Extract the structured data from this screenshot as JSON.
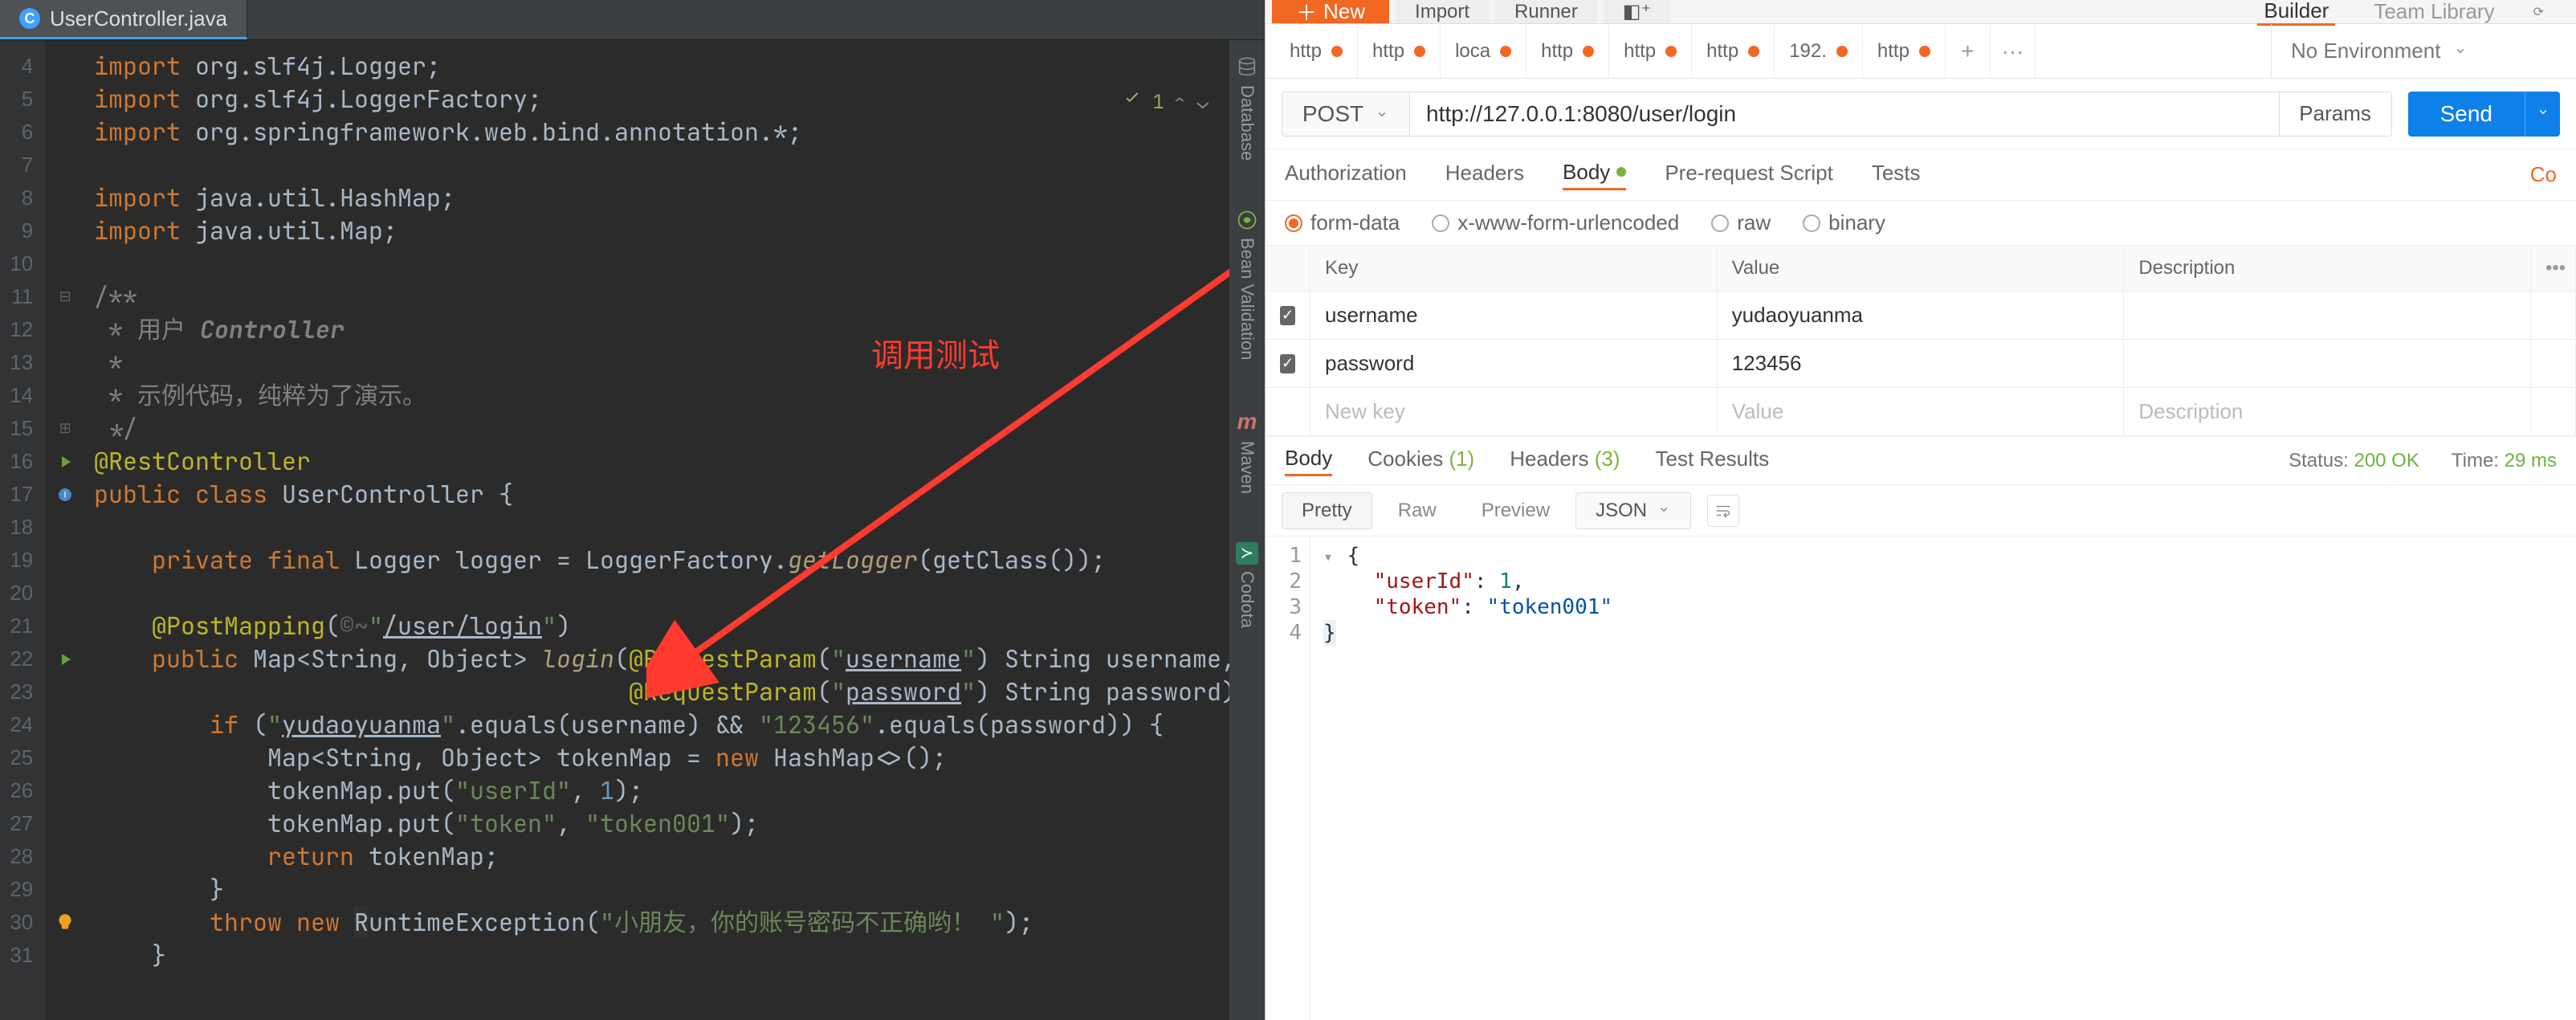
{
  "ide": {
    "tab": {
      "filename": "UserController.java"
    },
    "indicator": {
      "text": "1",
      "arrows": "⌃ ⌄"
    },
    "annotation": "调用测试",
    "side_tools": [
      "Database",
      "Bean Validation",
      "Maven",
      "Codota"
    ],
    "gutter": {
      "start": 4,
      "end": 31
    },
    "code": [
      {
        "n": 4,
        "html": "<span class='kw'>import</span> org.slf4j.Logger;"
      },
      {
        "n": 5,
        "html": "<span class='kw'>import</span> org.slf4j.LoggerFactory;"
      },
      {
        "n": 6,
        "html": "<span class='kw'>import</span> org.springframework.web.bind.annotation.*;"
      },
      {
        "n": 7,
        "html": ""
      },
      {
        "n": 8,
        "html": "<span class='kw'>import</span> java.util.HashMap;"
      },
      {
        "n": 9,
        "html": "<span class='kw'>import</span> java.util.Map;"
      },
      {
        "n": 10,
        "html": ""
      },
      {
        "n": 11,
        "html": "<span class='cmt'>/**</span>",
        "fold": "open"
      },
      {
        "n": 12,
        "html": "<span class='cmt'> * 用户 </span><span class='cmtkw'>Controller</span>"
      },
      {
        "n": 13,
        "html": "<span class='cmt'> *</span>"
      },
      {
        "n": 14,
        "html": "<span class='cmt'> * 示例代码，纯粹为了演示。</span>"
      },
      {
        "n": 15,
        "html": "<span class='cmt'> */</span>",
        "fold": "close"
      },
      {
        "n": 16,
        "html": "<span class='ann'>@RestController</span>",
        "decor": "run-green"
      },
      {
        "n": 17,
        "html": "<span class='kw'>public class</span> <span class='cls'>UserController</span> {",
        "decor": "impl"
      },
      {
        "n": 18,
        "html": ""
      },
      {
        "n": 19,
        "html": "    <span class='kw'>private final</span> Logger <span class='ident'>logger</span> = LoggerFactory.<span class='call'>getLogger</span>(getClass());"
      },
      {
        "n": 20,
        "html": ""
      },
      {
        "n": 21,
        "html": "    <span class='ann'>@PostMapping</span>(<span class='fold'>©~</span><span class='str'>\"</span><span class='str param'>/user/login</span><span class='str'>\"</span>)"
      },
      {
        "n": 22,
        "html": "    <span class='kw'>public</span> Map&lt;String, Object&gt; <span class='call'>login</span>(<span class='ann'>@RequestParam</span>(<span class='str'>\"</span><span class='str param'>username</span><span class='str'>\"</span>) String username,",
        "decor": "run-green"
      },
      {
        "n": 23,
        "html": "                                     <span class='ann'>@RequestParam</span>(<span class='str'>\"</span><span class='str param'>password</span><span class='str'>\"</span>) String password) {"
      },
      {
        "n": 24,
        "html": "        <span class='kw'>if</span> (<span class='str'>\"</span><span class='str param'>yudaoyuanma</span><span class='str'>\"</span>.equals(username) &amp;&amp; <span class='str'>\"123456\"</span>.equals(password)) {"
      },
      {
        "n": 25,
        "html": "            Map&lt;String, Object&gt; tokenMap = <span class='kw'>new</span> HashMap&lt;&gt;();"
      },
      {
        "n": 26,
        "html": "            tokenMap.put(<span class='str'>\"userId\"</span>, <span class='num'>1</span>);"
      },
      {
        "n": 27,
        "html": "            tokenMap.put(<span class='str'>\"token\"</span>, <span class='str'>\"token001\"</span>);"
      },
      {
        "n": 28,
        "html": "            <span class='kw'>return</span> tokenMap;"
      },
      {
        "n": 29,
        "html": "        }"
      },
      {
        "n": 30,
        "html": "        <span class='kw'>throw new</span> <span class='cursor-bg'>R</span>untimeException(<span class='str'>\"小朋友，你的账号密码不正确哟！ \"</span>);",
        "decor": "bulb"
      },
      {
        "n": 31,
        "html": "    }"
      }
    ]
  },
  "postman": {
    "topbar": {
      "new": "New",
      "import": "Import",
      "runner": "Runner",
      "builder": "Builder",
      "team": "Team Library"
    },
    "env": {
      "label": "No Environment"
    },
    "req_tabs": [
      {
        "label": "http",
        "dirty": true
      },
      {
        "label": "http",
        "dirty": true
      },
      {
        "label": "loca",
        "dirty": true
      },
      {
        "label": "http",
        "dirty": true
      },
      {
        "label": "http",
        "dirty": true
      },
      {
        "label": "http",
        "dirty": true
      },
      {
        "label": "192.",
        "dirty": true
      },
      {
        "label": "http",
        "dirty": true,
        "active": true
      }
    ],
    "tab_actions": {
      "plus": "+",
      "more": "···"
    },
    "url": {
      "method": "POST",
      "value": "http://127.0.0.1:8080/user/login",
      "params_btn": "Params",
      "send": "Send"
    },
    "section_tabs": {
      "auth": "Authorization",
      "headers": "Headers",
      "body": "Body",
      "prescript": "Pre-request Script",
      "tests": "Tests",
      "cookies": "Co"
    },
    "body_types": {
      "form": "form-data",
      "urlenc": "x-www-form-urlencoded",
      "raw": "raw",
      "binary": "binary"
    },
    "kv": {
      "head": {
        "key": "Key",
        "value": "Value",
        "desc": "Description"
      },
      "rows": [
        {
          "checked": true,
          "key": "username",
          "value": "yudaoyuanma"
        },
        {
          "checked": true,
          "key": "password",
          "value": "123456"
        }
      ],
      "placeholder": {
        "key": "New key",
        "value": "Value",
        "desc": "Description"
      }
    },
    "resp_tabs": {
      "body": "Body",
      "cookies": "Cookies",
      "cookies_n": "(1)",
      "headers": "Headers",
      "headers_n": "(3)",
      "tests": "Test Results"
    },
    "status": {
      "label": "Status:",
      "code": "200 OK",
      "time_label": "Time:",
      "time": "29 ms"
    },
    "view": {
      "pretty": "Pretty",
      "raw": "Raw",
      "preview": "Preview",
      "format": "JSON"
    },
    "resp_lines": [
      {
        "n": 1,
        "html": "<span class='jb'>{</span>",
        "fold": true
      },
      {
        "n": 2,
        "html": "    <span class='jk'>\"userId\"</span><span class='jb'>:</span> <span class='jn'>1</span><span class='jb'>,</span>"
      },
      {
        "n": 3,
        "html": "    <span class='jk'>\"token\"</span><span class='jb'>:</span> <span class='js'>\"token001\"</span>"
      },
      {
        "n": 4,
        "html": "<span class='hl'><span class='jb'>}</span></span>"
      }
    ]
  }
}
